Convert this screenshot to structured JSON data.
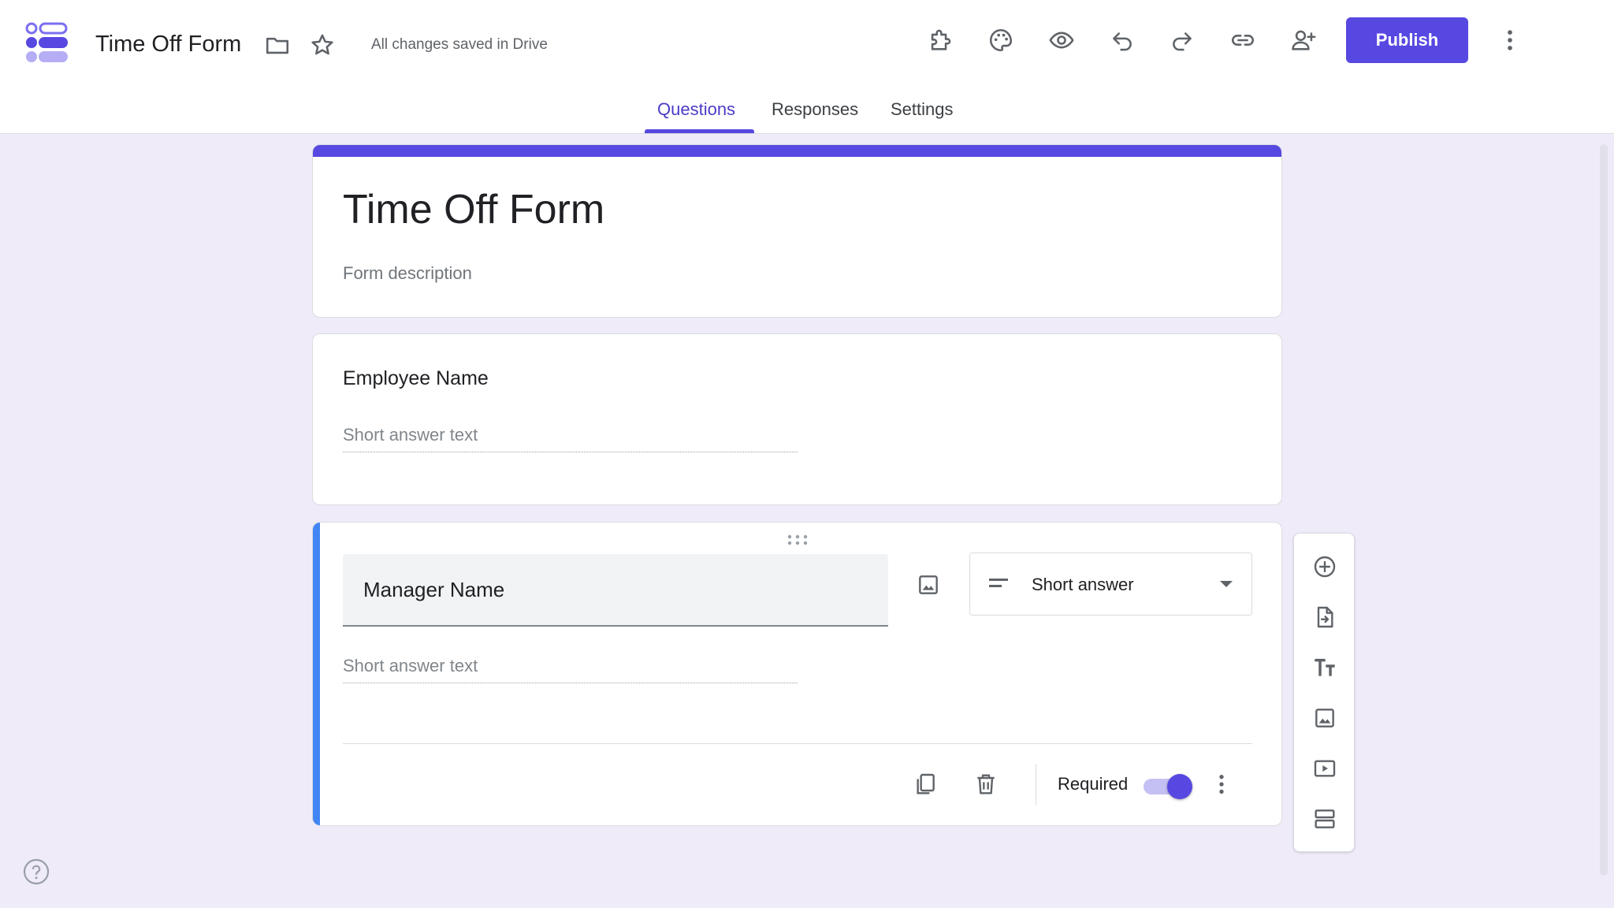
{
  "app": {
    "doc_title": "Time Off Form",
    "save_status": "All changes saved in Drive",
    "publish_label": "Publish",
    "accent_color": "#5748e1",
    "header_icons": [
      "folder-icon",
      "star-icon",
      "addon-puzzle-icon",
      "palette-icon",
      "preview-eye-icon",
      "undo-icon",
      "redo-icon",
      "link-icon",
      "add-collaborator-icon",
      "more-vert-icon"
    ]
  },
  "tabs": [
    {
      "label": "Questions",
      "active": true
    },
    {
      "label": "Responses",
      "active": false
    },
    {
      "label": "Settings",
      "active": false
    }
  ],
  "form": {
    "title": "Time Off Form",
    "description_placeholder": "Form description"
  },
  "questions": [
    {
      "title": "Employee Name",
      "answer_placeholder": "Short answer text"
    },
    {
      "title": "Manager Name",
      "answer_placeholder": "Short answer text",
      "type": "Short answer",
      "required_label": "Required",
      "required": true
    }
  ],
  "side_toolbar": [
    "add-question-icon",
    "import-questions-icon",
    "add-title-icon",
    "add-image-icon",
    "add-video-icon",
    "add-section-icon"
  ]
}
